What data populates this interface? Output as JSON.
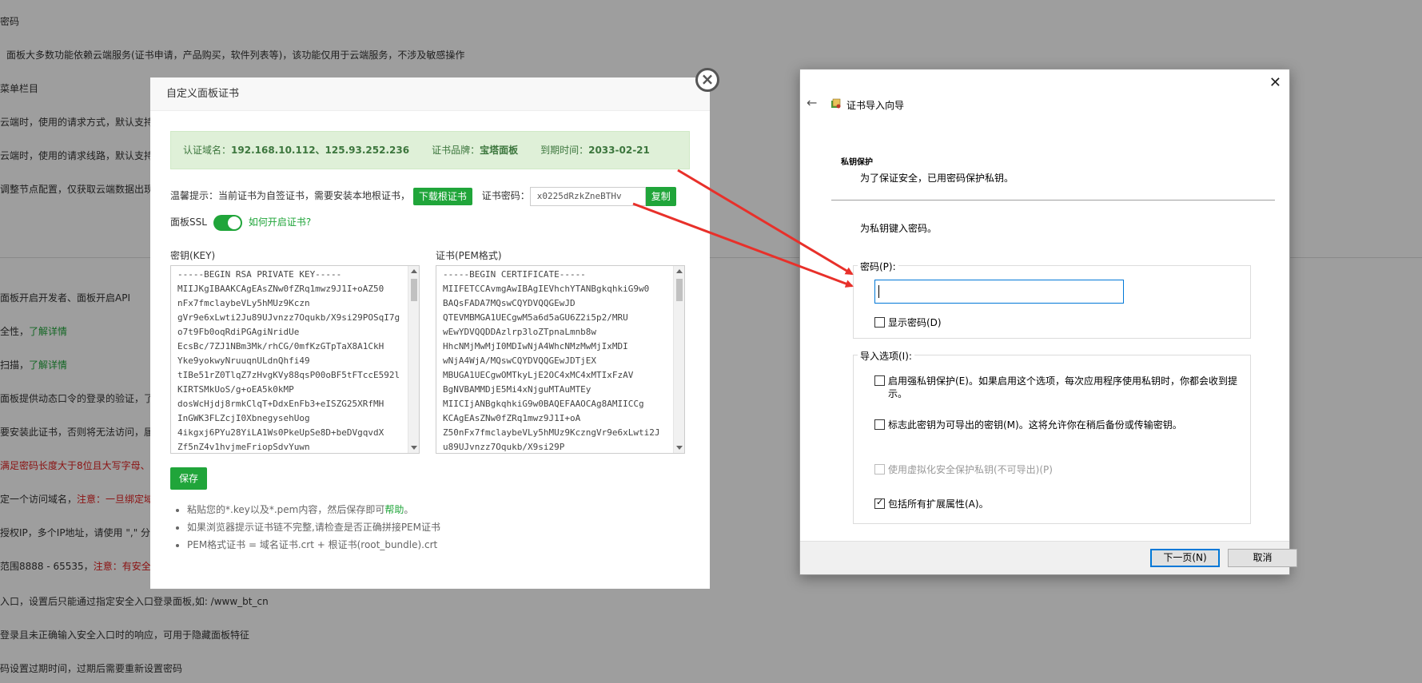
{
  "background": {
    "lines": [
      {
        "text": "密码"
      },
      {
        "text": "面板大多数功能依赖云端服务(证书申请，产品购买，软件列表等)，该功能仅用于云端服务，不涉及敏感操作"
      },
      {
        "text": "菜单栏目"
      },
      {
        "text": "云端时，使用的请求方式，默认支持"
      },
      {
        "text": "云端时，使用的请求线路，默认支持"
      },
      {
        "text": "调整节点配置，仅获取云端数据出现"
      },
      {
        "text": "面板开启开发者、面板开启API"
      },
      {
        "text": "全性，",
        "link": "了解详情"
      },
      {
        "text": "扫描，",
        "link": "了解详情"
      },
      {
        "text": "面板提供动态口令的登录的验证，了"
      },
      {
        "text": "要安装此证书，否则将无法访问，届"
      },
      {
        "text": "满足密码长度大于8位且大写字母、",
        "red": true
      },
      {
        "text": "定一个访问域名，",
        "warn": "注意：一旦绑定域"
      },
      {
        "text": "授权IP，多个IP地址，请使用 \",\" 分"
      },
      {
        "text": "范围8888 - 65535，",
        "warn": "注意：有安全组"
      },
      {
        "text": "入口，设置后只能通过指定安全入口登录面板,如: /www_bt_cn"
      },
      {
        "text": "登录且未正确输入安全入口时的响应，可用于隐藏面板特征"
      },
      {
        "text": "码设置过期时间，过期后需要重新设置密码"
      }
    ]
  },
  "panel_modal": {
    "title": "自定义面板证书",
    "close_glyph": "×",
    "cert_info": {
      "domain_label": "认证域名：",
      "domain_value": "192.168.10.112、125.93.252.236",
      "brand_label": "证书品牌：",
      "brand_value": "宝塔面板",
      "expire_label": "到期时间：",
      "expire_value": "2033-02-21"
    },
    "tip_text": "温馨提示：当前证书为自签证书，需要安装本地根证书，",
    "download_button": "下载根证书",
    "cert_pwd_label": "证书密码：",
    "cert_pwd_value": "x0225dRzkZneBTHv",
    "copy_button": "复制",
    "ssl_label": "面板SSL",
    "ssl_enabled": true,
    "ssl_help_link": "如何开启证书?",
    "key_label": "密钥(KEY)",
    "key_lines": [
      "-----BEGIN RSA PRIVATE KEY-----",
      "MIIJKgIBAAKCAgEAsZNw0fZRq1mwz9J1I+oAZ50",
      "nFx7fmclaybeVLy5hMUz9Kczn",
      "gVr9e6xLwti2Ju89UJvnzz7Oqukb/X9si29POSqI7g",
      "o7t9Fb0oqRdiPGAgiNridUe",
      "EcsBc/7ZJ1NBm3Mk/rhCG/0mfKzGTpTaX8A1CkH",
      "Yke9yokwyNruuqnULdnQhfi49",
      "tIBe51rZ0TlqZ7zHvgKVy88qsP00oBF5tFTccE592l",
      "KIRTSMkUoS/g+oEA5k0kMP",
      "dosWcHjdj8rmkClqT+DdxEnFb3+eISZG25XRfMH",
      "InGWK3FLZcjI0XbnegysehUog",
      "4ikgxj6PYu28YiLA1Ws0PkeUpSe8D+beDVgqvdX",
      "Zf5nZ4v1hvjmeFriopSdvYuwn"
    ],
    "pem_label": "证书(PEM格式)",
    "pem_lines": [
      "-----BEGIN CERTIFICATE-----",
      "MIIFETCCAvmgAwIBAgIEVhchYTANBgkqhkiG9w0",
      "BAQsFADA7MQswCQYDVQQGEwJD",
      "QTEVMBMGA1UECgwM5a6d5aGU6Z2i5p2/MRU",
      "wEwYDVQQDDAzlrp3loZTpnaLmnb8w",
      "HhcNMjMwMjI0MDIwNjA4WhcNMzMwMjIxMDI",
      "wNjA4WjA/MQswCQYDVQQGEwJDTjEX",
      "MBUGA1UECgwOMTkyLjE2OC4xMC4xMTIxFzAV",
      "BgNVBAMMDjE5Mi4xNjguMTAuMTEy",
      "MIICIjANBgkqhkiG9w0BAQEFAAOCAg8AMIICCg",
      "KCAgEAsZNw0fZRq1mwz9J1I+oA",
      "Z50nFx7fmclaybeVLy5hMUz9KczngVr9e6xLwti2J",
      "u89UJvnzz7Oqukb/X9si29P"
    ],
    "save_button": "保存",
    "notes": [
      {
        "text": "粘贴您的*.key以及*.pem内容，然后保存即可",
        "link": "帮助",
        "suffix": "。"
      },
      {
        "text": "如果浏览器提示证书链不完整,请检查是否正确拼接PEM证书"
      },
      {
        "text": "PEM格式证书 = 域名证书.crt + 根证书(root_bundle).crt"
      }
    ]
  },
  "wizard": {
    "close_glyph": "✕",
    "back_glyph": "←",
    "title": "证书导入向导",
    "section_title": "私钥保护",
    "section_desc": "为了保证安全，已用密码保护私钥。",
    "type_prompt": "为私钥键入密码。",
    "password_group": "密码(P):",
    "password_value": "",
    "show_password": "显示密码(D)",
    "import_group": "导入选项(I):",
    "options": [
      {
        "label": "启用强私钥保护(E)。如果启用这个选项，每次应用程序使用私钥时，你都会收到提",
        "label2": "示。",
        "checked": false,
        "disabled": false
      },
      {
        "label": "标志此密钥为可导出的密钥(M)。这将允许你在稍后备份或传输密钥。",
        "checked": false,
        "disabled": false
      },
      {
        "label": "使用虚拟化安全保护私钥(不可导出)(P)",
        "checked": false,
        "disabled": true
      },
      {
        "label": "包括所有扩展属性(A)。",
        "checked": true,
        "disabled": false
      }
    ],
    "next_button": "下一页(N)",
    "cancel_button": "取消"
  },
  "annotation": {
    "arrow_color": "#e8302a"
  }
}
